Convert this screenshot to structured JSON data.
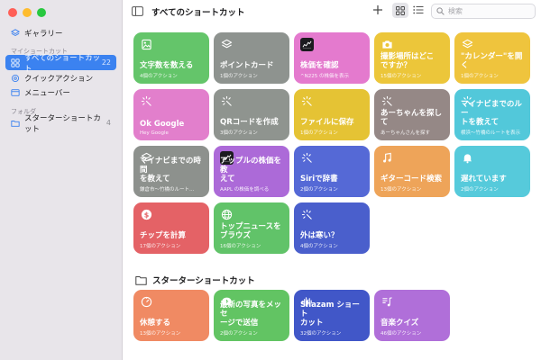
{
  "sidebar": {
    "gallery": "ギャラリー",
    "section_my": "マイショートカット",
    "all": "すべてのショートカット",
    "all_count": "22",
    "quick": "クイックアクション",
    "menubar": "メニューバー",
    "section_folders": "フォルダ",
    "starter": "スターターショートカット",
    "starter_count": "4"
  },
  "toolbar": {
    "title": "すべてのショートカット",
    "search_placeholder": "検索"
  },
  "tiles": [
    {
      "name": "文字数を数える",
      "sub": "4個のアクション",
      "color": "#64c56a",
      "icon": "photo-icon"
    },
    {
      "name": "ポイントカード",
      "sub": "1個のアクション",
      "color": "#8e938f",
      "icon": "layers-icon"
    },
    {
      "name": "株価を確認",
      "sub": "^N225 の株価を表示",
      "color": "#e47ace",
      "icon": "stocks-app-icon"
    },
    {
      "name": "撮影場所はどこ\nですか？",
      "sub": "15個のアクション",
      "color": "#ecc63a",
      "icon": "camera-icon"
    },
    {
      "name": "\"カレンダー\"を開く",
      "sub": "1個のアクション",
      "color": "#efc43d",
      "icon": "layers-icon"
    },
    {
      "name": "Ok Google",
      "sub": "Hey Google",
      "color": "#e27fcc",
      "icon": "sparkle-icon"
    },
    {
      "name": "QRコードを作成",
      "sub": "3個のアクション",
      "color": "#8f948f",
      "icon": "sparkle-icon"
    },
    {
      "name": "ファイルに保存",
      "sub": "1個のアクション",
      "color": "#e5c334",
      "icon": "sparkle-icon"
    },
    {
      "name": "あーちゃんを探して",
      "sub": "あーちゃんさんを探す",
      "color": "#958886",
      "icon": "sparkle-icon"
    },
    {
      "name": "マイナビまでのルー\nトを教えて",
      "sub": "横浜〜竹橋のルートを表示",
      "color": "#52c8da",
      "icon": "sparkle-icon"
    },
    {
      "name": "マイナビまでの時間\nを教えて",
      "sub": "鎌倉市〜竹橋のルート…",
      "color": "#8d918d",
      "icon": "layers-icon"
    },
    {
      "name": "アップルの株価を教\nえて",
      "sub": "AAPL の株価を調べる",
      "color": "#ac6ad8",
      "icon": "stocks-app-icon"
    },
    {
      "name": "Siriで辞書",
      "sub": "2個のアクション",
      "color": "#5569d6",
      "icon": "sparkle-icon"
    },
    {
      "name": "ギターコード検索",
      "sub": "13個のアクション",
      "color": "#eea459",
      "icon": "music-note-icon"
    },
    {
      "name": "遅れています",
      "sub": "2個のアクション",
      "color": "#56cadb",
      "icon": "bell-icon"
    },
    {
      "name": "チップを計算",
      "sub": "17個のアクション",
      "color": "#e46266",
      "icon": "dollar-icon"
    },
    {
      "name": "トップニュースを\nブラウズ",
      "sub": "16個のアクション",
      "color": "#61c369",
      "icon": "globe-icon"
    },
    {
      "name": "外は寒い？",
      "sub": "4個のアクション",
      "color": "#4a5fcc",
      "icon": "sparkle-icon"
    }
  ],
  "starter_section": {
    "title": "スターターショートカット",
    "tiles": [
      {
        "name": "休憩する",
        "sub": "13個のアクション",
        "color": "#f08a63",
        "icon": "timer-icon"
      },
      {
        "name": "最新の写真をメッセ\nージで送信",
        "sub": "2個のアクション",
        "color": "#62c463",
        "icon": "message-plus-icon"
      },
      {
        "name": "Shazam ショート\nカット",
        "sub": "32個のアクション",
        "color": "#4157c8",
        "icon": "waveform-icon"
      },
      {
        "name": "音楽クイズ",
        "sub": "46個のアクション",
        "color": "#b06fd9",
        "icon": "music-list-icon"
      }
    ]
  }
}
